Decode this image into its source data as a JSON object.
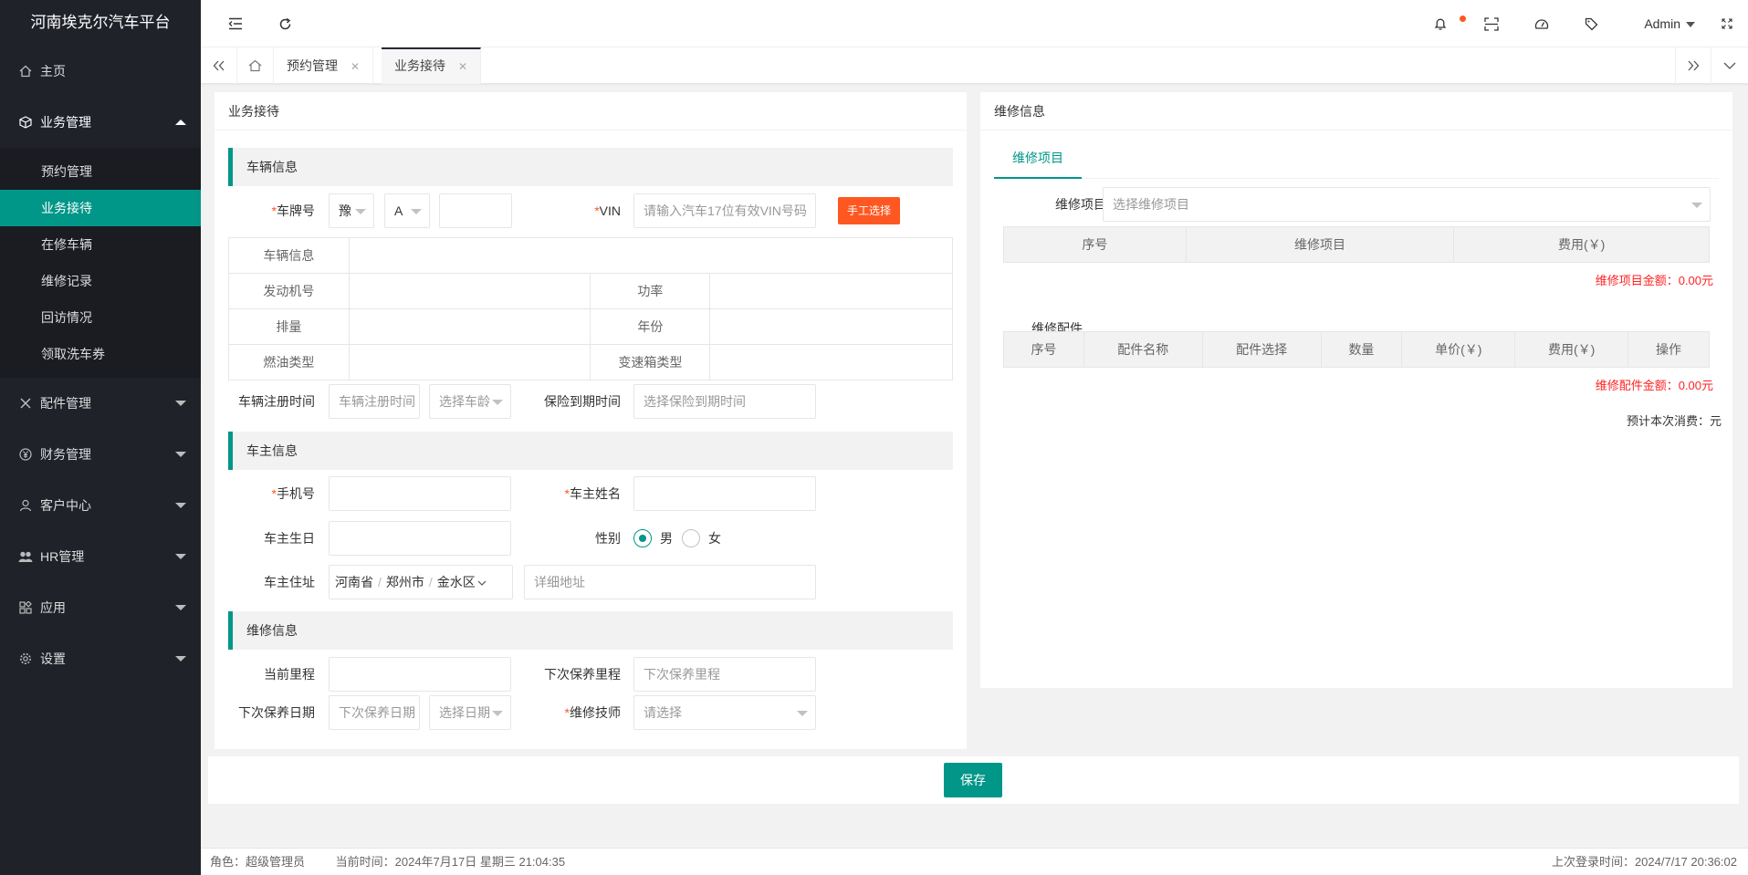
{
  "app": {
    "title": "河南埃克尔汽车平台"
  },
  "sidebar": {
    "items": [
      {
        "label": "主页",
        "icon": "home-icon"
      },
      {
        "label": "业务管理",
        "icon": "cube-icon"
      },
      {
        "label": "配件管理",
        "icon": "tools-icon"
      },
      {
        "label": "财务管理",
        "icon": "yen-icon"
      },
      {
        "label": "客户中心",
        "icon": "user-icon"
      },
      {
        "label": "HR管理",
        "icon": "users-icon"
      },
      {
        "label": "应用",
        "icon": "apps-icon"
      },
      {
        "label": "设置",
        "icon": "gear-icon"
      }
    ],
    "sub_items": [
      "预约管理",
      "业务接待",
      "在修车辆",
      "维修记录",
      "回访情况",
      "领取洗车券"
    ]
  },
  "header": {
    "admin": "Admin"
  },
  "tabs": [
    {
      "label": "预约管理"
    },
    {
      "label": "业务接待"
    }
  ],
  "left_panel": {
    "title": "业务接待",
    "vehicle": {
      "section": "车辆信息",
      "plate_label": "车牌号",
      "plate_province": "豫",
      "plate_letter": "A",
      "vin_label": "VIN",
      "vin_placeholder": "请输入汽车17位有效VIN号码",
      "manual_button": "手工选择",
      "table": {
        "vehicle_info": "车辆信息",
        "engine_no": "发动机号",
        "power": "功率",
        "displacement": "排量",
        "year": "年份",
        "fuel_type": "燃油类型",
        "gearbox_type": "变速箱类型"
      },
      "reg_time_label": "车辆注册时间",
      "reg_time_placeholder": "车辆注册时间",
      "age_placeholder": "选择车龄",
      "insurance_label": "保险到期时间",
      "insurance_placeholder": "选择保险到期时间"
    },
    "owner": {
      "section": "车主信息",
      "phone_label": "手机号",
      "name_label": "车主姓名",
      "birthday_label": "车主生日",
      "gender_label": "性别",
      "gender_male": "男",
      "gender_female": "女",
      "address_label": "车主住址",
      "province": "河南省",
      "city": "郑州市",
      "district": "金水区",
      "address_placeholder": "详细地址"
    },
    "repair": {
      "section": "维修信息",
      "mileage_label": "当前里程",
      "next_mileage_label": "下次保养里程",
      "next_mileage_placeholder": "下次保养里程",
      "next_date_label": "下次保养日期",
      "next_date_placeholder": "下次保养日期",
      "select_date_placeholder": "选择日期",
      "tech_label": "维修技师",
      "tech_placeholder": "请选择"
    }
  },
  "right_panel": {
    "title": "维修信息",
    "tab": "维修项目",
    "item_label": "维修项目",
    "item_placeholder": "选择维修项目",
    "items_table_headers": [
      "序号",
      "维修项目",
      "费用(￥)"
    ],
    "items_total": "维修项目金额：0.00元",
    "parts_label": "维修配件",
    "parts_table_headers": [
      "序号",
      "配件名称",
      "配件选择",
      "数量",
      "单价(￥)",
      "费用(￥)",
      "操作"
    ],
    "parts_total": "维修配件金额：0.00元",
    "estimate": "预计本次消费：元"
  },
  "actions": {
    "save": "保存"
  },
  "footer": {
    "role": "角色：超级管理员",
    "current_time": "当前时间：2024年7月17日 星期三 21:04:35",
    "last_login": "上次登录时间：2024/7/17 20:36:02"
  },
  "colors": {
    "accent": "#009688",
    "warn": "#ff5722",
    "sidebar": "#20222a"
  }
}
